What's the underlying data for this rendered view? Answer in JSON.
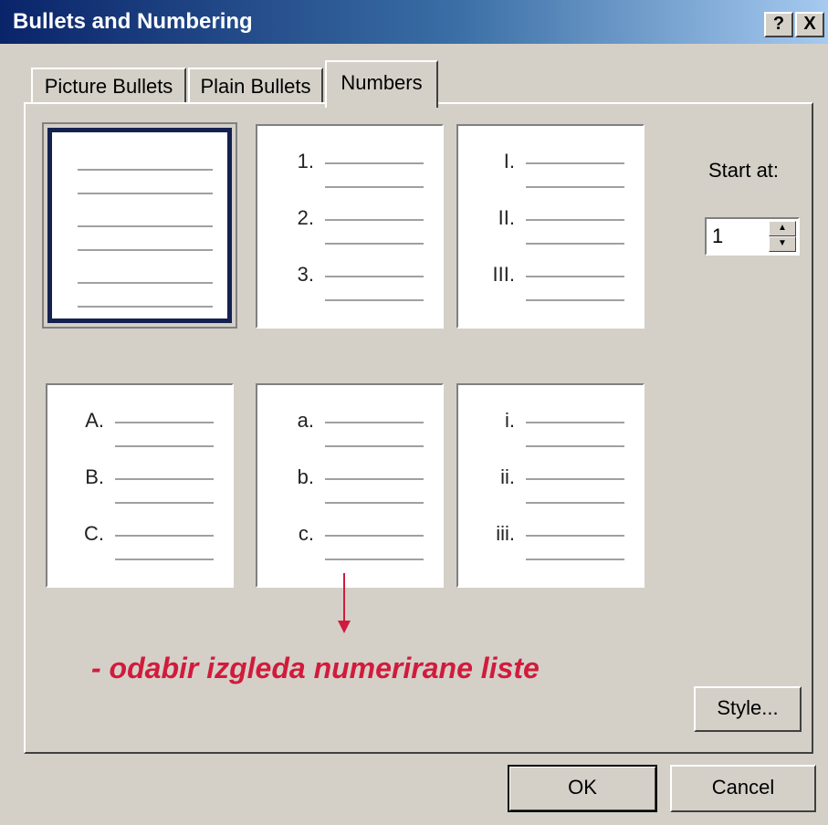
{
  "window": {
    "title": "Bullets and Numbering",
    "help_label": "?",
    "close_label": "X"
  },
  "tabs": [
    {
      "label": "Picture Bullets",
      "active": false
    },
    {
      "label": "Plain Bullets",
      "active": false
    },
    {
      "label": "Numbers",
      "active": true
    }
  ],
  "styles": [
    {
      "labels": [
        "",
        "",
        ""
      ],
      "selected": true
    },
    {
      "labels": [
        "1.",
        "2.",
        "3."
      ],
      "selected": false
    },
    {
      "labels": [
        "I.",
        "II.",
        "III."
      ],
      "selected": false
    },
    {
      "labels": [
        "A.",
        "B.",
        "C."
      ],
      "selected": false
    },
    {
      "labels": [
        "a.",
        "b.",
        "c."
      ],
      "selected": false
    },
    {
      "labels": [
        "i.",
        "ii.",
        "iii."
      ],
      "selected": false
    }
  ],
  "start_at": {
    "label": "Start at:",
    "value": "1"
  },
  "annotation": {
    "text": "- odabir izgleda numerirane liste",
    "color": "#d11b3c"
  },
  "buttons": {
    "style": "Style...",
    "ok": "OK",
    "cancel": "Cancel"
  },
  "colors": {
    "face": "#d4d0c8",
    "title_start": "#0a246a",
    "selection": "#14214f"
  }
}
